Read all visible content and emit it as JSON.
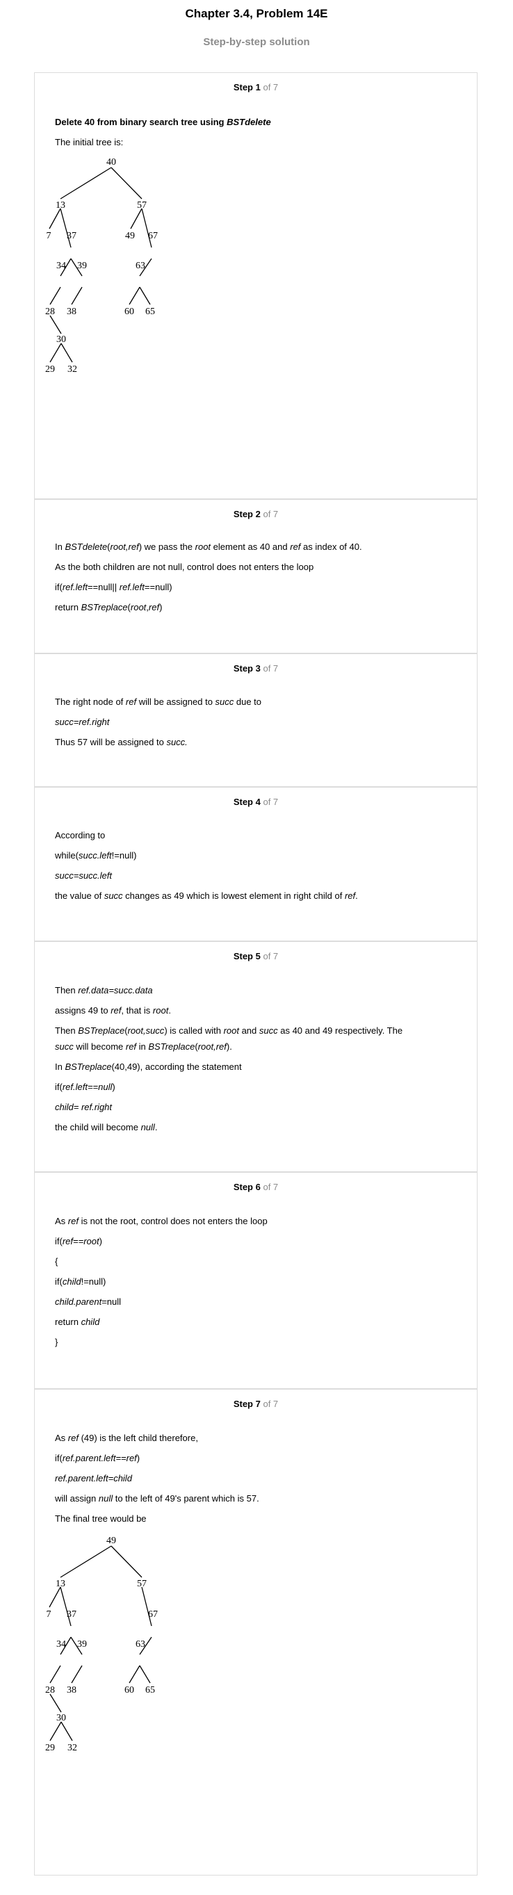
{
  "header": {
    "title": "Chapter 3.4, Problem 14E",
    "subtitle": "Step-by-step solution"
  },
  "of_total": "of 7",
  "steps": [
    {
      "label": "Step 1",
      "lines": [
        {
          "parts": [
            {
              "t": "Delete 40 from binary search tree using "
            },
            {
              "t": "BSTdelete",
              "i": true
            }
          ],
          "bold": true
        },
        {
          "parts": [
            {
              "t": "The initial tree is:"
            }
          ]
        }
      ],
      "tree_labels": [
        "40",
        "13",
        "57",
        "7",
        "37",
        "49",
        "67",
        "34",
        "39",
        "63",
        "28",
        "38",
        "60",
        "65",
        "30",
        "29",
        "32"
      ]
    },
    {
      "label": "Step 2",
      "lines": [
        {
          "parts": [
            {
              "t": "In "
            },
            {
              "t": "BSTdelete",
              "i": true
            },
            {
              "t": "("
            },
            {
              "t": "root,ref",
              "i": true
            },
            {
              "t": ") we pass the "
            },
            {
              "t": "root",
              "i": true
            },
            {
              "t": " element as 40 and "
            },
            {
              "t": "ref",
              "i": true
            },
            {
              "t": " as index of 40."
            }
          ]
        },
        {
          "parts": [
            {
              "t": "As the both children are not null, control does not enters the loop"
            }
          ]
        },
        {
          "parts": [
            {
              "t": "if("
            },
            {
              "t": "ref.left",
              "i": true
            },
            {
              "t": "==null|| "
            },
            {
              "t": "ref.left",
              "i": true
            },
            {
              "t": "==null)"
            }
          ]
        },
        {
          "parts": [
            {
              "t": "return "
            },
            {
              "t": "BSTreplace",
              "i": true
            },
            {
              "t": "("
            },
            {
              "t": "root",
              "i": true
            },
            {
              "t": ","
            },
            {
              "t": "ref",
              "i": true
            },
            {
              "t": ")"
            }
          ]
        }
      ]
    },
    {
      "label": "Step 3",
      "lines": [
        {
          "parts": [
            {
              "t": "The right node of "
            },
            {
              "t": "ref",
              "i": true
            },
            {
              "t": " will be assigned to "
            },
            {
              "t": "succ",
              "i": true
            },
            {
              "t": " due to"
            }
          ]
        },
        {
          "parts": [
            {
              "t": "succ=ref.right",
              "i": true
            }
          ]
        },
        {
          "parts": [
            {
              "t": "Thus 57 will be assigned to "
            },
            {
              "t": "succ.",
              "i": true
            }
          ]
        }
      ]
    },
    {
      "label": "Step 4",
      "lines": [
        {
          "parts": [
            {
              "t": "According to"
            }
          ]
        },
        {
          "parts": [
            {
              "t": "while("
            },
            {
              "t": "succ.left",
              "i": true
            },
            {
              "t": "!=null)"
            }
          ]
        },
        {
          "parts": [
            {
              "t": "succ=succ.left",
              "i": true
            }
          ]
        },
        {
          "parts": [
            {
              "t": "the value of "
            },
            {
              "t": "succ",
              "i": true
            },
            {
              "t": " changes as 49 which is lowest element in right child of "
            },
            {
              "t": "ref",
              "i": true
            },
            {
              "t": "."
            }
          ]
        }
      ]
    },
    {
      "label": "Step 5",
      "lines": [
        {
          "parts": [
            {
              "t": "Then "
            },
            {
              "t": "ref.data=succ.data",
              "i": true
            }
          ]
        },
        {
          "parts": [
            {
              "t": "assigns 49 to "
            },
            {
              "t": "ref",
              "i": true
            },
            {
              "t": ", that is "
            },
            {
              "t": "root",
              "i": true
            },
            {
              "t": "."
            }
          ]
        },
        {
          "parts": [
            {
              "t": "Then "
            },
            {
              "t": "BSTreplace",
              "i": true
            },
            {
              "t": "("
            },
            {
              "t": "root,succ",
              "i": true
            },
            {
              "t": ") is called with "
            },
            {
              "t": "root",
              "i": true
            },
            {
              "t": " and "
            },
            {
              "t": "succ",
              "i": true
            },
            {
              "t": " as 40 and 49 respectively. The"
            }
          ]
        },
        {
          "parts": [
            {
              "t": "succ",
              "i": true
            },
            {
              "t": " will become "
            },
            {
              "t": "ref",
              "i": true
            },
            {
              "t": " in "
            },
            {
              "t": "BSTreplace",
              "i": true
            },
            {
              "t": "("
            },
            {
              "t": "root,ref",
              "i": true
            },
            {
              "t": ")."
            }
          ]
        },
        {
          "parts": [
            {
              "t": "In "
            },
            {
              "t": "BSTreplace",
              "i": true
            },
            {
              "t": "(40,49), according the statement"
            }
          ]
        },
        {
          "parts": [
            {
              "t": "if("
            },
            {
              "t": "ref.left==null",
              "i": true
            },
            {
              "t": ")"
            }
          ]
        },
        {
          "parts": [
            {
              "t": "child= ref.right",
              "i": true
            }
          ]
        },
        {
          "parts": [
            {
              "t": "the child will become "
            },
            {
              "t": "null",
              "i": true
            },
            {
              "t": "."
            }
          ]
        }
      ]
    },
    {
      "label": "Step 6",
      "lines": [
        {
          "parts": [
            {
              "t": "As "
            },
            {
              "t": "ref",
              "i": true
            },
            {
              "t": " is not the root, control does not enters the loop"
            }
          ]
        },
        {
          "parts": [
            {
              "t": "if("
            },
            {
              "t": "ref==root",
              "i": true
            },
            {
              "t": ")"
            }
          ]
        },
        {
          "parts": [
            {
              "t": "{"
            }
          ]
        },
        {
          "parts": [
            {
              "t": "if("
            },
            {
              "t": "child",
              "i": true
            },
            {
              "t": "!=null)"
            }
          ]
        },
        {
          "parts": [
            {
              "t": "child.parent",
              "i": true
            },
            {
              "t": "=null"
            }
          ]
        },
        {
          "parts": [
            {
              "t": "return "
            },
            {
              "t": "child",
              "i": true
            }
          ]
        },
        {
          "parts": [
            {
              "t": "}"
            }
          ]
        }
      ]
    },
    {
      "label": "Step 7",
      "lines": [
        {
          "parts": [
            {
              "t": "As "
            },
            {
              "t": "ref",
              "i": true
            },
            {
              "t": " (49) is the left child therefore,"
            }
          ]
        },
        {
          "parts": [
            {
              "t": "if("
            },
            {
              "t": "ref.parent.left==ref",
              "i": true
            },
            {
              "t": ")"
            }
          ]
        },
        {
          "parts": [
            {
              "t": "ref.parent.left=child",
              "i": true
            }
          ]
        },
        {
          "parts": [
            {
              "t": "will assign "
            },
            {
              "t": "null",
              "i": true
            },
            {
              "t": " to the left of 49's parent which is 57."
            }
          ]
        },
        {
          "parts": [
            {
              "t": "The final tree would be"
            }
          ]
        }
      ],
      "tree_labels": [
        "49",
        "13",
        "57",
        "7",
        "37",
        "67",
        "34",
        "39",
        "63",
        "28",
        "38",
        "60",
        "65",
        "30",
        "29",
        "32"
      ]
    }
  ]
}
